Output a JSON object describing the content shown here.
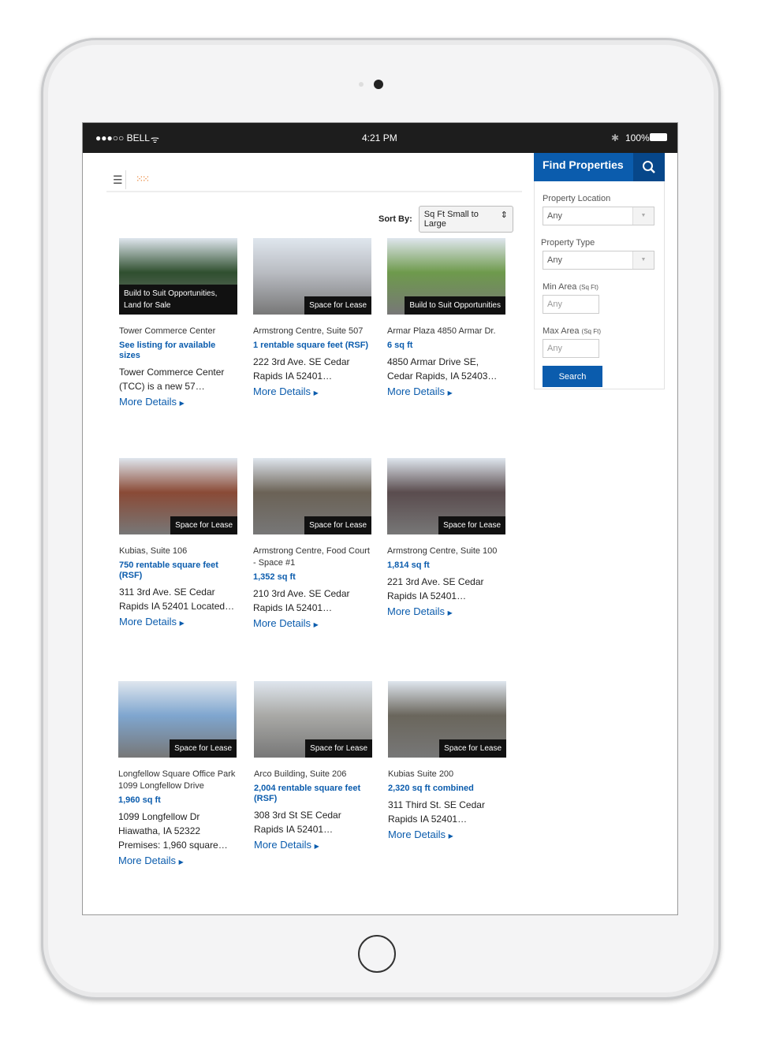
{
  "status": {
    "carrier": "●●●○○ BELL",
    "time": "4:21 PM",
    "battery": "100%"
  },
  "toolbar": {
    "sort_label": "Sort By:",
    "sort_value": "Sq Ft Small to Large"
  },
  "sidebar": {
    "title": "Find Properties",
    "location_label": "Property Location",
    "location_value": "Any",
    "type_label": "Property Type",
    "type_value": "Any",
    "min_label": "Min Area",
    "max_label": "Max Area",
    "unit": "(Sq Ft)",
    "min_placeholder": "Any",
    "max_placeholder": "Any",
    "search_label": "Search"
  },
  "colors": {
    "accent": "#0b5cad",
    "grid_icon": "#e87722"
  },
  "more_label": "More Details",
  "listings": [
    {
      "badge": "Build to Suit Opportunities, Land for Sale",
      "name": "Tower Commerce Center",
      "size": "See listing for available sizes",
      "desc": "Tower Commerce Center (TCC) is a new 57…",
      "img": "#2f4f2f"
    },
    {
      "badge": "Space for Lease",
      "name": "Armstrong Centre, Suite 507",
      "size": "1 rentable square feet (RSF)",
      "desc": "222 3rd Ave. SE Cedar Rapids IA 52401…",
      "img": "#b9bcc2"
    },
    {
      "badge": "Build to Suit Opportunities",
      "name": "Armar Plaza 4850 Armar Dr.",
      "size": "6 sq ft",
      "desc": "4850 Armar Drive SE, Cedar Rapids, IA 52403…",
      "img": "#6e9a4c"
    },
    {
      "badge": "Space for Lease",
      "name": "Kubias, Suite 106",
      "size": "750 rentable square feet (RSF)",
      "desc": "311 3rd Ave. SE Cedar Rapids IA 52401 Located…",
      "img": "#8a4a36"
    },
    {
      "badge": "Space for Lease",
      "name": "Armstrong Centre, Food Court - Space #1",
      "size": "1,352 sq ft",
      "desc": "210 3rd Ave. SE Cedar Rapids IA 52401…",
      "img": "#6b6256"
    },
    {
      "badge": "Space for Lease",
      "name": "Armstrong Centre, Suite 100",
      "size": "1,814 sq ft",
      "desc": "221 3rd Ave. SE Cedar Rapids IA 52401…",
      "img": "#5a4c4e"
    },
    {
      "badge": "Space for Lease",
      "name": "Longfellow Square Office Park 1099 Longfellow Drive",
      "size": "1,960 sq ft",
      "desc": "1099 Longfellow Dr Hiawatha, IA 52322 Premises: 1,960 square…",
      "img": "#7fa6cf"
    },
    {
      "badge": "Space for Lease",
      "name": "Arco Building, Suite 206",
      "size": "2,004 rentable square feet (RSF)",
      "desc": "308 3rd St SE Cedar Rapids IA 52401…",
      "img": "#a9a9a6"
    },
    {
      "badge": "Space for Lease",
      "name": "Kubias Suite 200",
      "size": "2,320 sq ft combined",
      "desc": "311 Third St. SE Cedar Rapids IA 52401…",
      "img": "#6a665c"
    }
  ]
}
